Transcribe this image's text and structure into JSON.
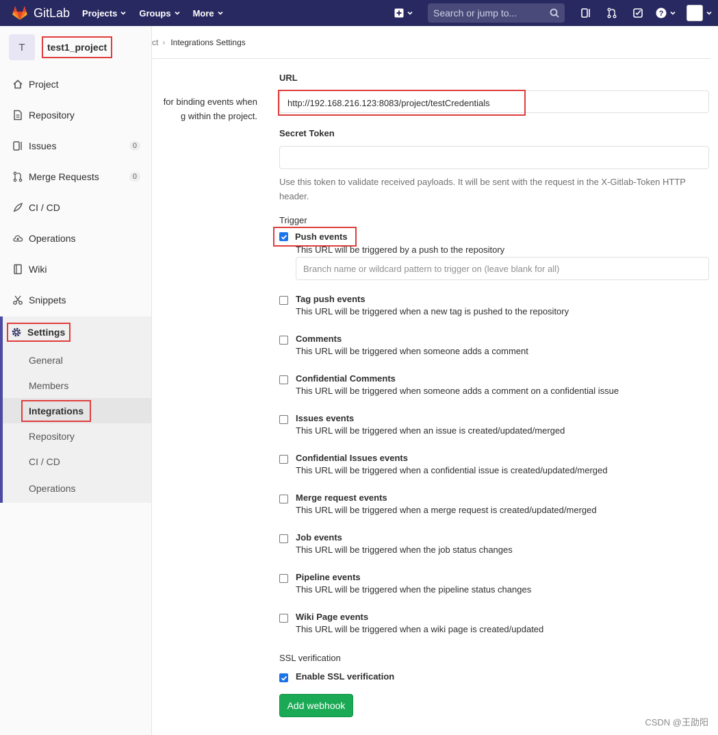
{
  "header": {
    "app_name": "GitLab",
    "nav": [
      "Projects",
      "Groups",
      "More"
    ],
    "search_placeholder": "Search or jump to..."
  },
  "sidebar": {
    "project_initial": "T",
    "project_name": "test1_project",
    "items": [
      {
        "label": "Project",
        "icon": "home-icon"
      },
      {
        "label": "Repository",
        "icon": "doc-icon"
      },
      {
        "label": "Issues",
        "icon": "issues-icon",
        "count": "0"
      },
      {
        "label": "Merge Requests",
        "icon": "merge-request-icon",
        "count": "0"
      },
      {
        "label": "CI / CD",
        "icon": "rocket-icon"
      },
      {
        "label": "Operations",
        "icon": "cloud-gear-icon"
      },
      {
        "label": "Wiki",
        "icon": "book-icon"
      },
      {
        "label": "Snippets",
        "icon": "scissors-icon"
      }
    ],
    "settings_label": "Settings",
    "settings_sub": [
      "General",
      "Members",
      "Integrations",
      "Repository",
      "CI / CD",
      "Operations"
    ]
  },
  "breadcrumb": {
    "prev_fragment": "ct",
    "current": "Integrations Settings"
  },
  "left_desc": "for binding events when\ng within the project.",
  "form": {
    "url_label": "URL",
    "url_value": "http://192.168.216.123:8083/project/testCredentials",
    "secret_label": "Secret Token",
    "secret_help": "Use this token to validate received payloads. It will be sent with the request in the X-Gitlab-Token HTTP header.",
    "trigger_label": "Trigger",
    "branch_placeholder": "Branch name or wildcard pattern to trigger on (leave blank for all)",
    "triggers": [
      {
        "title": "Push events",
        "desc": "This URL will be triggered by a push to the repository",
        "checked": true
      },
      {
        "title": "Tag push events",
        "desc": "This URL will be triggered when a new tag is pushed to the repository",
        "checked": false
      },
      {
        "title": "Comments",
        "desc": "This URL will be triggered when someone adds a comment",
        "checked": false
      },
      {
        "title": "Confidential Comments",
        "desc": "This URL will be triggered when someone adds a comment on a confidential issue",
        "checked": false
      },
      {
        "title": "Issues events",
        "desc": "This URL will be triggered when an issue is created/updated/merged",
        "checked": false
      },
      {
        "title": "Confidential Issues events",
        "desc": "This URL will be triggered when a confidential issue is created/updated/merged",
        "checked": false
      },
      {
        "title": "Merge request events",
        "desc": "This URL will be triggered when a merge request is created/updated/merged",
        "checked": false
      },
      {
        "title": "Job events",
        "desc": "This URL will be triggered when the job status changes",
        "checked": false
      },
      {
        "title": "Pipeline events",
        "desc": "This URL will be triggered when the pipeline status changes",
        "checked": false
      },
      {
        "title": "Wiki Page events",
        "desc": "This URL will be triggered when a wiki page is created/updated",
        "checked": false
      }
    ],
    "ssl_label": "SSL verification",
    "ssl_option": "Enable SSL verification",
    "submit": "Add webhook"
  },
  "watermark": "CSDN @王劭阳",
  "colors": {
    "header": "#292961",
    "button": "#1aaa55",
    "highlight": "#e03c3c",
    "checkbox": "#1a73e8"
  }
}
